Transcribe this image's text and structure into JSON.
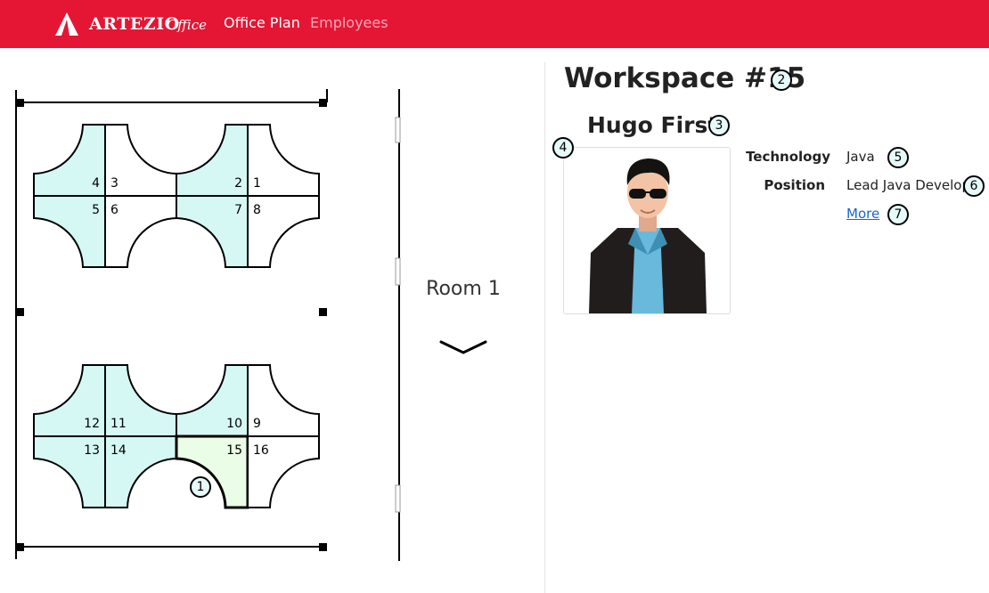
{
  "header": {
    "brand": "ARTEZIO",
    "brand_sub": "Office",
    "nav": [
      "Office Plan",
      "Employees"
    ]
  },
  "plan": {
    "seats": [
      "1",
      "2",
      "3",
      "4",
      "5",
      "6",
      "7",
      "8",
      "9",
      "10",
      "11",
      "12",
      "13",
      "14",
      "15",
      "16"
    ],
    "selected_seat": "15",
    "room_label": "Room 1"
  },
  "workspace": {
    "title": "Workspace #15",
    "employee_name": "Hugo First",
    "technology_label": "Technology",
    "technology_value": "Java",
    "position_label": "Position",
    "position_value": "Lead Java Developer",
    "more_link": "More"
  },
  "markers": [
    "1",
    "2",
    "3",
    "4",
    "5",
    "6",
    "7"
  ],
  "colors": {
    "header_bg": "#e41634",
    "desk_fill": "#d5f8f4",
    "selected_fill": "#eafde6",
    "link": "#1a66cc"
  }
}
